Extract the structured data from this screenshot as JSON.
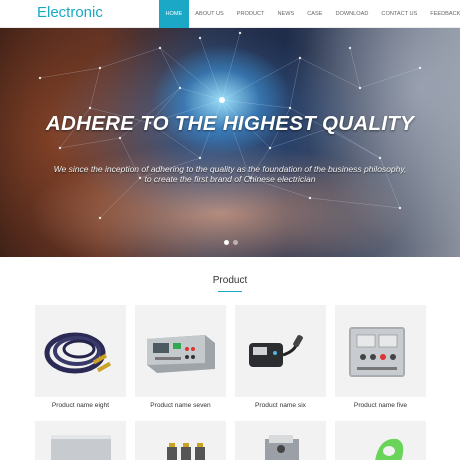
{
  "header": {
    "logo": "Electronic",
    "nav": [
      "HOME",
      "ABOUT US",
      "PRODUCT",
      "NEWS",
      "CASE",
      "DOWNLOAD",
      "CONTACT US",
      "FEEDBACK"
    ],
    "active_nav": "HOME"
  },
  "banner": {
    "title": "ADHERE TO THE HIGHEST QUALITY",
    "subtitle_line1": "We since the inception of adhering to the quality as the foundation of the business philosophy,",
    "subtitle_line2": "to create the first brand of Chinese electrician",
    "slides": 2,
    "active_slide": 1
  },
  "products": {
    "title": "Product",
    "items": [
      {
        "name": "Product name eight",
        "icon": "cable-icon"
      },
      {
        "name": "Product name seven",
        "icon": "test-instrument-icon"
      },
      {
        "name": "Product name six",
        "icon": "power-inverter-icon"
      },
      {
        "name": "Product name five",
        "icon": "control-box-icon"
      }
    ],
    "row2_icons": [
      "device-icon",
      "terminal-block-icon",
      "tester-icon",
      "green-clamp-icon"
    ]
  },
  "colors": {
    "accent": "#1aa8c6",
    "card_bg": "#f2f2f2"
  }
}
